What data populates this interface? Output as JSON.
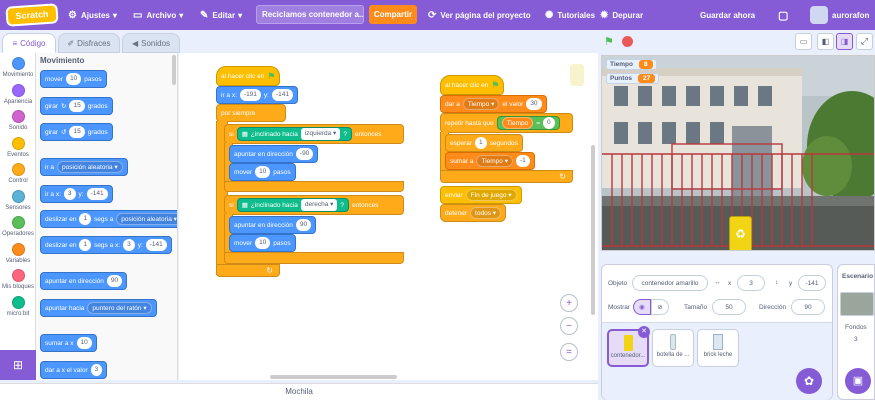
{
  "menu": {
    "logo": "Scratch",
    "settings": "Ajustes",
    "file": "Archivo",
    "edit": "Editar",
    "project_title": "Reciclamos contenedor a...",
    "share": "Compartir",
    "see_project": "Ver página del proyecto",
    "tutorials": "Tutoriales",
    "debug": "Depurar",
    "save_now": "Guardar ahora",
    "username": "aurorafon"
  },
  "tabs": {
    "code": "Código",
    "costumes": "Disfraces",
    "sounds": "Sonidos"
  },
  "categories": [
    {
      "label": "Movimiento",
      "color": "#4c97ff"
    },
    {
      "label": "Apariencia",
      "color": "#9966ff"
    },
    {
      "label": "Sonido",
      "color": "#cf63cf"
    },
    {
      "label": "Eventos",
      "color": "#ffbf00"
    },
    {
      "label": "Control",
      "color": "#ffab19"
    },
    {
      "label": "Sensores",
      "color": "#5cb1d6"
    },
    {
      "label": "Operadores",
      "color": "#59c059"
    },
    {
      "label": "Variables",
      "color": "#ff8c1a"
    },
    {
      "label": "Mis bloques",
      "color": "#ff6680"
    },
    {
      "label": "micro:bit",
      "color": "#0fbd8c"
    }
  ],
  "palette": {
    "heading": "Movimiento",
    "move": "mover",
    "move_val": "10",
    "steps": "pasos",
    "turn": "girar",
    "turn_right_val": "15",
    "turn_left_val": "15",
    "degrees": "grados",
    "goto": "ir a",
    "goto_opt": "posición aleatoria",
    "goto_xy": "ir a x:",
    "goto_x": "3",
    "goto_y_label": "y:",
    "goto_y": "-141",
    "glide": "deslizar en",
    "glide_val": "1",
    "glide_secs": "segs a",
    "glide_opt": "posición aleatoria",
    "glide_xy_val": "1",
    "glide_xy_secs": "segs a x:",
    "glide_x": "3",
    "glide_y_label": "y:",
    "glide_y": "-141",
    "point_dir": "apuntar en dirección",
    "point_dir_val": "90",
    "point_to": "apuntar hacia",
    "point_to_opt": "puntero del ratón",
    "change_x": "sumar a x",
    "change_x_val": "10",
    "set_x": "dar a x el valor",
    "set_x_val": "3"
  },
  "script1": {
    "hat": "al hacer clic en",
    "goto": "ir a x:",
    "x": "-191",
    "y_label": "y:",
    "y": "-141",
    "forever": "por siempre",
    "if1": "si",
    "tilted1": "¿inclinado hacia",
    "tilted1_opt": "izquierda",
    "q1": "?",
    "then1": "entonces",
    "point1": "apuntar en dirección",
    "point1_val": "-90",
    "move1": "mover",
    "move1_val": "10",
    "steps1": "pasos",
    "if2": "si",
    "tilted2": "¿inclinado hacia",
    "tilted2_opt": "derecha",
    "q2": "?",
    "then2": "entonces",
    "point2": "apuntar en dirección",
    "point2_val": "90",
    "move2": "mover",
    "move2_val": "10",
    "steps2": "pasos"
  },
  "script2": {
    "hat": "al hacer clic en",
    "set": "dar a",
    "set_var": "Tiempo",
    "set_label": "el valor",
    "set_val": "30",
    "repeat": "repetir hasta que",
    "var": "Tiempo",
    "eq": "=",
    "eq_val": "0",
    "wait": "esperar",
    "wait_val": "1",
    "wait_secs": "segundos",
    "change": "sumar a",
    "change_var": "Tiempo",
    "change_val": "-1",
    "broadcast": "enviar",
    "broadcast_opt": "Fin de juego",
    "stop": "detener",
    "stop_opt": "todos"
  },
  "backpack": "Mochila",
  "stage": {
    "monitor1_label": "Tiempo",
    "monitor1_val": "8",
    "monitor2_label": "Puntos",
    "monitor2_val": "27"
  },
  "sprite": {
    "object_label": "Objeto",
    "name": "contenedor amarillo",
    "x_label": "x",
    "x": "3",
    "y_label": "y",
    "y": "-141",
    "show_label": "Mostrar",
    "size_label": "Tamaño",
    "size": "50",
    "dir_label": "Dirección",
    "dir": "90",
    "tiles": [
      "contenedor...",
      "botella de ...",
      "brick leche"
    ]
  },
  "stage_pane": {
    "title": "Escenario",
    "backdrops_label": "Fondos",
    "backdrops": "3"
  }
}
